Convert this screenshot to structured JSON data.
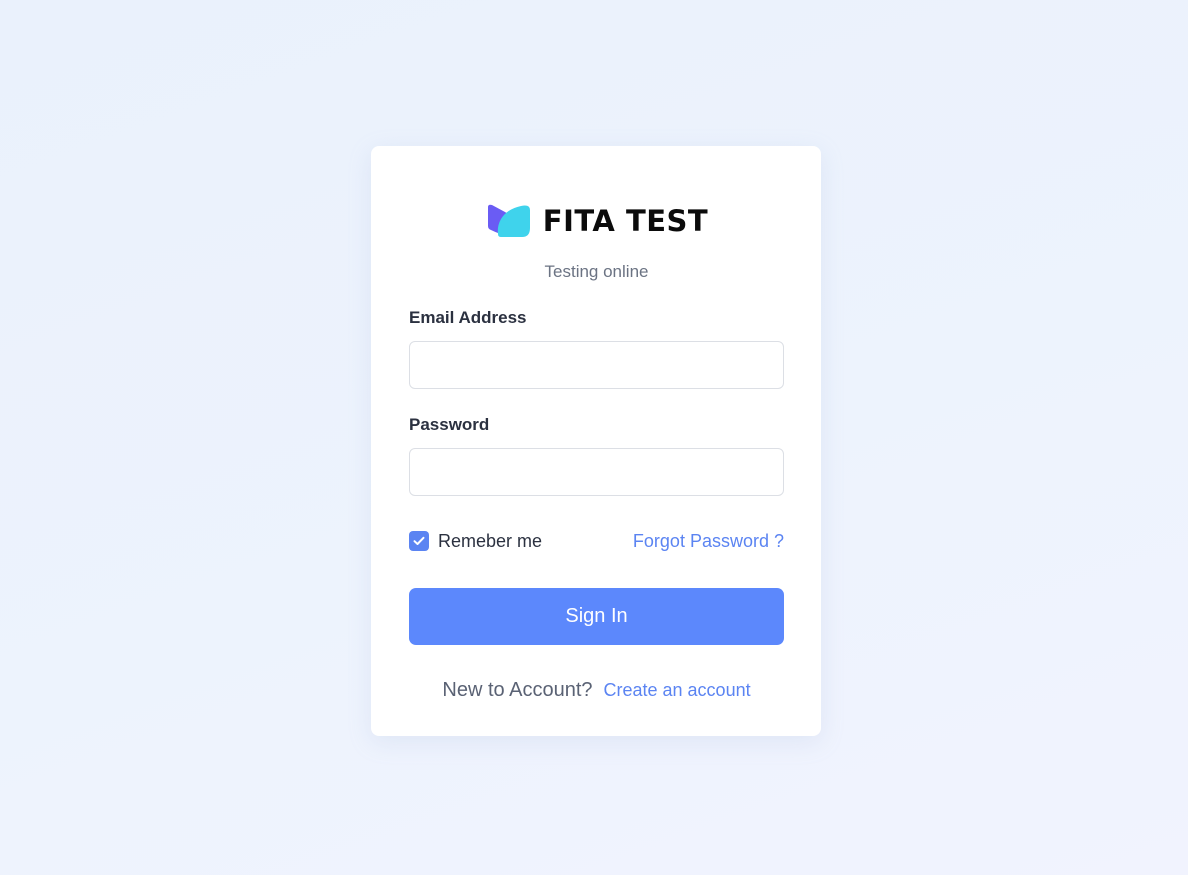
{
  "brand": {
    "name": "FITA TEST",
    "tagline": "Testing online",
    "logo_icon": "book-logo-icon",
    "logo_colors": [
      "#6a5cf4",
      "#3fd3ec"
    ]
  },
  "form": {
    "email_label": "Email Address",
    "email_value": "",
    "password_label": "Password",
    "password_value": "",
    "remember_label": "Remeber me",
    "remember_checked": true,
    "forgot_label": "Forgot Password ?",
    "submit_label": "Sign In"
  },
  "footer": {
    "prompt": "New to Account?",
    "create_label": "Create an account"
  },
  "colors": {
    "accent": "#5c88fc",
    "link": "#5b84f2"
  }
}
